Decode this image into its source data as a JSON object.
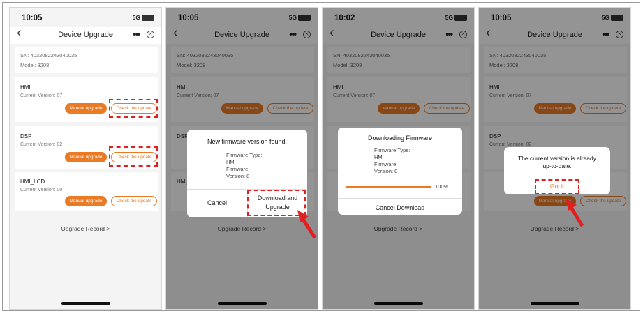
{
  "colors": {
    "accent": "#ea7a23",
    "highlight": "#e02020"
  },
  "common": {
    "sn": "SN: 4032082243040035",
    "model": "Model: 3208",
    "nav_title": "Device Upgrade",
    "back_icon": "chevron-left-icon",
    "more_icon": "more-icon",
    "close_icon": "close-circle-icon",
    "hmi": "HMI",
    "hmi_version": "Current Version: 07",
    "dsp": "DSP",
    "dsp_version": "Current Version: 02",
    "hmi_lcd": "HMI_LCD",
    "hmi_lcd_version": "Current Version: 00",
    "manual_upgrade": "Manual upgrade",
    "check_update": "Check the update",
    "upgrade_record": "Upgrade Record >"
  },
  "screens": [
    {
      "time": "10:05",
      "signal": "5G"
    },
    {
      "time": "10:05",
      "signal": "5G"
    },
    {
      "time": "10:02",
      "signal": "5G"
    },
    {
      "time": "10:05",
      "signal": "5G"
    }
  ],
  "dialog_found": {
    "title": "New firmware version found.",
    "firmware_type_label": "Firmware Type:",
    "firmware_type_value": "HMI",
    "firmware_version_label": "Firmware",
    "firmware_version_value": "Version: 8",
    "cancel": "Cancel",
    "download_line1": "Download and",
    "download_line2": "Upgrade"
  },
  "dialog_downloading": {
    "title": "Downloading Firmware",
    "firmware_type_label": "Firmware Type:",
    "firmware_type_value": "HMI",
    "firmware_version_label": "Firmware",
    "firmware_version_value": "Version: 8",
    "progress_text": "100%",
    "progress_value": 1.0,
    "cancel_download": "Cancel Download"
  },
  "dialog_uptodate": {
    "line1": "The current version is already",
    "line2": "up-to-date.",
    "got_it": "Got it"
  }
}
